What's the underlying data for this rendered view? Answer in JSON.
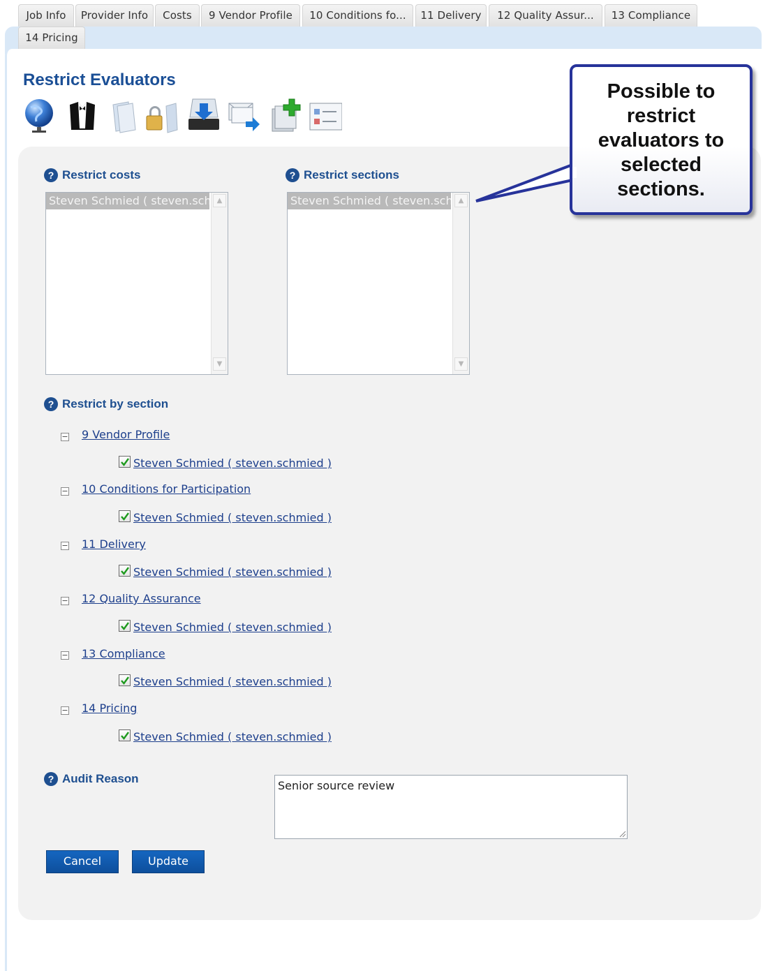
{
  "tabs": [
    "Job Info",
    "Provider Info",
    "Costs",
    "9 Vendor Profile",
    "10 Conditions fo...",
    "11 Delivery",
    "12 Quality Assur...",
    "13 Compliance",
    "14 Pricing"
  ],
  "page": {
    "title": "Restrict Evaluators"
  },
  "toolbar": {
    "icons": [
      "globe-icon",
      "tuxedo-icon",
      "locked-documents-icon",
      "download-tray-icon",
      "forward-mail-icon",
      "add-documents-icon",
      "form-list-icon"
    ]
  },
  "restrict_costs": {
    "label": "Restrict costs",
    "selected_item": "Steven Schmied ( steven.schmied )"
  },
  "restrict_sections": {
    "label": "Restrict sections",
    "selected_item": "Steven Schmied ( steven.schmied )"
  },
  "restrict_by_section": {
    "label": "Restrict by section",
    "toggle_glyph": "−",
    "sections": [
      {
        "name": "9 Vendor Profile",
        "member": "Steven Schmied ( steven.schmied )",
        "checked": true
      },
      {
        "name": "10 Conditions for Participation",
        "member": "Steven Schmied ( steven.schmied )",
        "checked": true
      },
      {
        "name": "11 Delivery",
        "member": "Steven Schmied ( steven.schmied )",
        "checked": true
      },
      {
        "name": "12 Quality Assurance",
        "member": "Steven Schmied ( steven.schmied )",
        "checked": true
      },
      {
        "name": "13 Compliance",
        "member": "Steven Schmied ( steven.schmied )",
        "checked": true
      },
      {
        "name": "14 Pricing",
        "member": "Steven Schmied ( steven.schmied )",
        "checked": true
      }
    ]
  },
  "audit": {
    "label": "Audit Reason",
    "value": "Senior source review"
  },
  "buttons": {
    "cancel": "Cancel",
    "update": "Update"
  },
  "help_glyph": "?",
  "callout": {
    "text": "Possible to restrict evaluators to selected sections."
  },
  "colors": {
    "accent": "#1e4f90",
    "button": "#0e4f9c",
    "callout_border": "#27339a",
    "tab_band": "#d9e8f7"
  }
}
